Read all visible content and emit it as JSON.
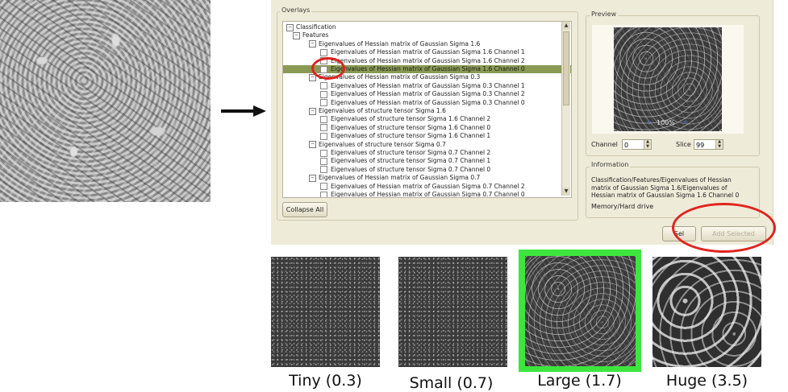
{
  "overlays": {
    "title": "Overlays",
    "tree": [
      {
        "text": "Classification",
        "depth": 0,
        "kind": "expander",
        "glyph": "−"
      },
      {
        "text": "Features",
        "depth": 1,
        "kind": "expander",
        "glyph": "−"
      },
      {
        "text": "Eigenvalues of Hessian matrix of Gaussian Sigma 1.6",
        "depth": 2,
        "kind": "expander",
        "glyph": "−"
      },
      {
        "text": "Eigenvalues of Hessian matrix of Gaussian Sigma 1.6 Channel 1",
        "depth": 3,
        "kind": "check"
      },
      {
        "text": "Eigenvalues of Hessian matrix of Gaussian Sigma 1.6 Channel 2",
        "depth": 3,
        "kind": "check"
      },
      {
        "text": "Eigenvalues of Hessian matrix of Gaussian Sigma 1.6 Channel 0",
        "depth": 3,
        "kind": "check",
        "selected": true
      },
      {
        "text": "Eigenvalues of Hessian matrix of Gaussian Sigma 0.3",
        "depth": 2,
        "kind": "expander",
        "glyph": "−"
      },
      {
        "text": "Eigenvalues of Hessian matrix of Gaussian Sigma 0.3 Channel 1",
        "depth": 3,
        "kind": "check"
      },
      {
        "text": "Eigenvalues of Hessian matrix of Gaussian Sigma 0.3 Channel 2",
        "depth": 3,
        "kind": "check"
      },
      {
        "text": "Eigenvalues of Hessian matrix of Gaussian Sigma 0.3 Channel 0",
        "depth": 3,
        "kind": "check"
      },
      {
        "text": "Eigenvalues of structure tensor Sigma 1.6",
        "depth": 2,
        "kind": "expander",
        "glyph": "−"
      },
      {
        "text": "Eigenvalues of structure tensor Sigma 1.6 Channel 2",
        "depth": 3,
        "kind": "check"
      },
      {
        "text": "Eigenvalues of structure tensor Sigma 1.6 Channel 0",
        "depth": 3,
        "kind": "check"
      },
      {
        "text": "Eigenvalues of structure tensor Sigma 1.6 Channel 1",
        "depth": 3,
        "kind": "check"
      },
      {
        "text": "Eigenvalues of structure tensor Sigma 0.7",
        "depth": 2,
        "kind": "expander",
        "glyph": "−"
      },
      {
        "text": "Eigenvalues of structure tensor Sigma 0.7 Channel 2",
        "depth": 3,
        "kind": "check"
      },
      {
        "text": "Eigenvalues of structure tensor Sigma 0.7 Channel 1",
        "depth": 3,
        "kind": "check"
      },
      {
        "text": "Eigenvalues of structure tensor Sigma 0.7 Channel 0",
        "depth": 3,
        "kind": "check"
      },
      {
        "text": "Eigenvalues of Hessian matrix of Gaussian Sigma 0.7",
        "depth": 2,
        "kind": "expander",
        "glyph": "−"
      },
      {
        "text": "Eigenvalues of Hessian matrix of Gaussian Sigma 0.7 Channel 2",
        "depth": 3,
        "kind": "check"
      },
      {
        "text": "Eigenvalues of Hessian matrix of Gaussian Sigma 0.7 Channel 0",
        "depth": 3,
        "kind": "check"
      }
    ],
    "collapse_label": "Collapse All"
  },
  "preview": {
    "title": "Preview",
    "zoom": "100%",
    "zoom_out": "−",
    "zoom_in": "+",
    "channel_label": "Channel",
    "channel_value": "0",
    "slice_label": "Slice",
    "slice_value": "99"
  },
  "information": {
    "title": "Information",
    "text": "Classification/Features/Eigenvalues of Hessian matrix of Gaussian Sigma 1.6/Eigenvalues of Hessian matrix of Gaussian Sigma 1.6 Channel 0",
    "memory_label": "Memory/Hard drive"
  },
  "buttons": {
    "ok_label": "Sel",
    "add_selected_label": "Add Selected"
  },
  "scales": [
    {
      "label": "Tiny (0.3)"
    },
    {
      "label": "Small (0.7)"
    },
    {
      "label": "Large (1.7)"
    },
    {
      "label": "Huge (3.5)"
    }
  ],
  "colors": {
    "highlight_border": "#3ee53e",
    "annotation_red": "#e1231e",
    "selection": "#8a9a55"
  }
}
